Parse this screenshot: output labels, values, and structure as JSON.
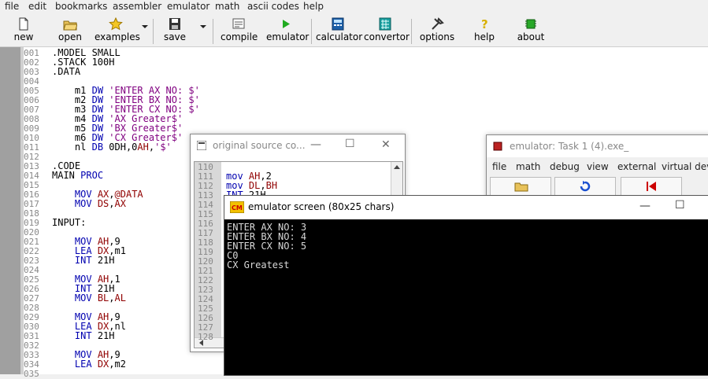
{
  "menu": [
    "file",
    "edit",
    "bookmarks",
    "assembler",
    "emulator",
    "math",
    "ascii codes",
    "help"
  ],
  "toolbar": {
    "new": "new",
    "open": "open",
    "examples": "examples",
    "save": "save",
    "compile": "compile",
    "emulator": "emulator",
    "calculator": "calculator",
    "convertor": "convertor",
    "options": "options",
    "help": "help",
    "about": "about"
  },
  "editor": {
    "line_numbers": [
      "001",
      "002",
      "003",
      "004",
      "005",
      "006",
      "007",
      "008",
      "009",
      "010",
      "011",
      "012",
      "013",
      "014",
      "015",
      "016",
      "017",
      "018",
      "019",
      "020",
      "021",
      "022",
      "023",
      "024",
      "025",
      "026",
      "027",
      "028",
      "029",
      "030",
      "031",
      "032",
      "033",
      "034",
      "035"
    ],
    "lines": [
      ".MODEL SMALL",
      ".STACK 100H",
      ".DATA",
      "",
      "    m1 DW 'ENTER AX NO: $'",
      "    m2 DW 'ENTER BX NO: $'",
      "    m3 DW 'ENTER CX NO: $'",
      "    m4 DW 'AX Greater$'",
      "    m5 DW 'BX Greater$'",
      "    m6 DW 'CX Greater$'",
      "    nl DB 0DH,0AH,'$'",
      "",
      ".CODE",
      "MAIN PROC",
      "",
      "    MOV AX,@DATA",
      "    MOV DS,AX",
      "",
      "INPUT:",
      "",
      "    MOV AH,9",
      "    LEA DX,m1",
      "    INT 21H",
      "",
      "    MOV AH,1",
      "    INT 21H",
      "    MOV BL,AL",
      "",
      "    MOV AH,9",
      "    LEA DX,nl",
      "    INT 21H",
      "",
      "    MOV AH,9",
      "    LEA DX,m2"
    ]
  },
  "source_window": {
    "title": "original source co...",
    "line_numbers": [
      "110",
      "111",
      "112",
      "113",
      "114",
      "115",
      "116",
      "117",
      "118",
      "119",
      "120",
      "121",
      "122",
      "123",
      "124",
      "125",
      "126",
      "127",
      "128"
    ],
    "code": [
      "",
      "mov AH,2",
      "mov DL,BH",
      "INT 21H"
    ]
  },
  "emulator_window": {
    "title": "emulator: Task 1 (4).exe_",
    "menu": [
      "file",
      "math",
      "debug",
      "view",
      "external",
      "virtual device"
    ]
  },
  "screen_window": {
    "title": "emulator screen (80x25 chars)",
    "output": [
      "ENTER AX NO: 3",
      "ENTER BX NO: 4",
      "ENTER CX NO: 5",
      "C0",
      "CX Greatest"
    ]
  },
  "colors": {
    "accent": "#0000b0",
    "register": "#900000",
    "string": "#800080",
    "screen_bg": "#000000"
  }
}
